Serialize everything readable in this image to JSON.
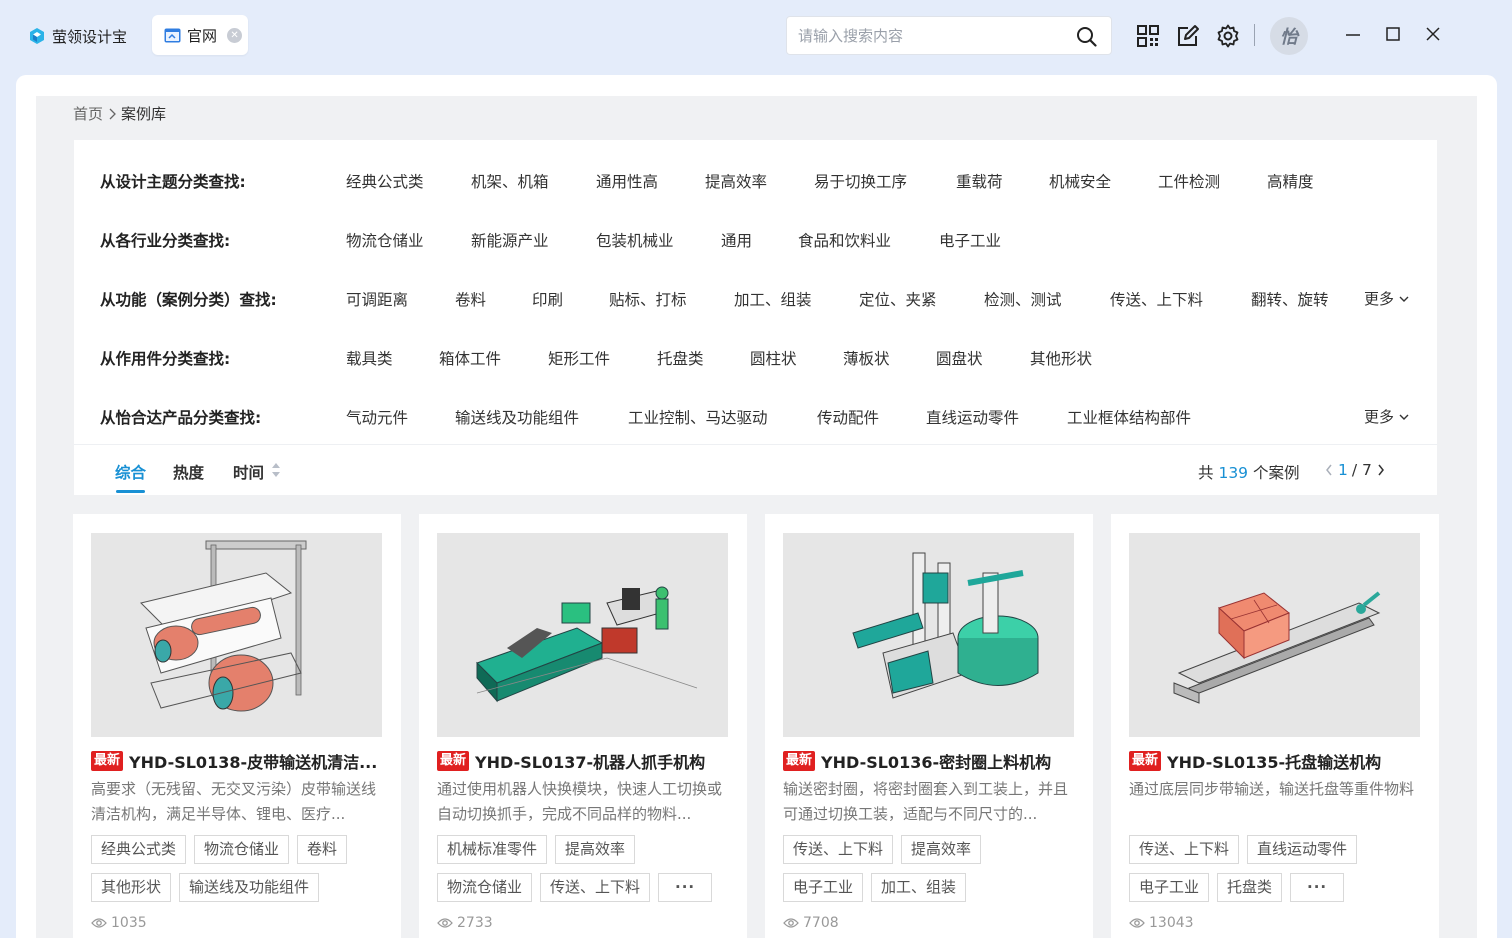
{
  "titlebar": {
    "app_name": "萤领设计宝",
    "tab_label": "官网",
    "search_placeholder": "请输入搜索内容",
    "avatar_text": "怡"
  },
  "breadcrumb": {
    "home": "首页",
    "current": "案例库"
  },
  "filters": [
    {
      "label": "从设计主题分类查找:",
      "options": [
        "经典公式类",
        "机架、机箱",
        "通用性高",
        "提高效率",
        "易于切换工序",
        "重载荷",
        "机械安全",
        "工件检测",
        "高精度"
      ],
      "more": ""
    },
    {
      "label": "从各行业分类查找:",
      "options": [
        "物流仓储业",
        "新能源产业",
        "包装机械业",
        "通用",
        "食品和饮料业",
        "电子工业"
      ],
      "more": ""
    },
    {
      "label": "从功能（案例分类）查找:",
      "options": [
        "可调距离",
        "卷料",
        "印刷",
        "贴标、打标",
        "加工、组装",
        "定位、夹紧",
        "检测、测试",
        "传送、上下料",
        "翻转、旋转"
      ],
      "more": "更多"
    },
    {
      "label": "从作用件分类查找:",
      "options": [
        "载具类",
        "箱体工件",
        "矩形工件",
        "托盘类",
        "圆柱状",
        "薄板状",
        "圆盘状",
        "其他形状"
      ],
      "more": ""
    },
    {
      "label": "从怡合达产品分类查找:",
      "options": [
        "气动元件",
        "输送线及功能组件",
        "工业控制、马达驱动",
        "传动配件",
        "直线运动零件",
        "工业框体结构部件"
      ],
      "more": "更多"
    }
  ],
  "sort": {
    "tab1": "综合",
    "tab2": "热度",
    "tab3": "时间"
  },
  "summary": {
    "prefix": "共",
    "count": "139",
    "suffix": "个案例",
    "page_current": "1",
    "page_total": "/ 7"
  },
  "colors": {
    "accent": "#1890d4",
    "badge": "#e02020"
  },
  "cards": [
    {
      "badge": "最新",
      "title": "YHD-SL0138-皮带输送机清洁...",
      "desc": "高要求（无残留、无交叉污染）皮带输送线清洁机构，满足半导体、锂电、医疗...",
      "tags_row1": [
        "经典公式类",
        "物流仓储业",
        "卷料"
      ],
      "tags_row2": [
        "其他形状",
        "输送线及功能组件"
      ],
      "views": "1035"
    },
    {
      "badge": "最新",
      "title": "YHD-SL0137-机器人抓手机构",
      "desc": "通过使用机器人快换模块，快速人工切换或自动切换抓手，完成不同品样的物料...",
      "tags_row1": [
        "机械标准零件",
        "提高效率"
      ],
      "tags_row2": [
        "物流仓储业",
        "传送、上下料",
        "···"
      ],
      "views": "2733"
    },
    {
      "badge": "最新",
      "title": "YHD-SL0136-密封圈上料机构",
      "desc": "输送密封圈，将密封圈套入到工装上，并且可通过切换工装，适配与不同尺寸的...",
      "tags_row1": [
        "传送、上下料",
        "提高效率"
      ],
      "tags_row2": [
        "电子工业",
        "加工、组装"
      ],
      "views": "7708"
    },
    {
      "badge": "最新",
      "title": "YHD-SL0135-托盘输送机构",
      "desc": "通过底层同步带输送，输送托盘等重件物料",
      "tags_row1": [
        "传送、上下料",
        "直线运动零件"
      ],
      "tags_row2": [
        "电子工业",
        "托盘类",
        "···"
      ],
      "views": "13043"
    }
  ]
}
